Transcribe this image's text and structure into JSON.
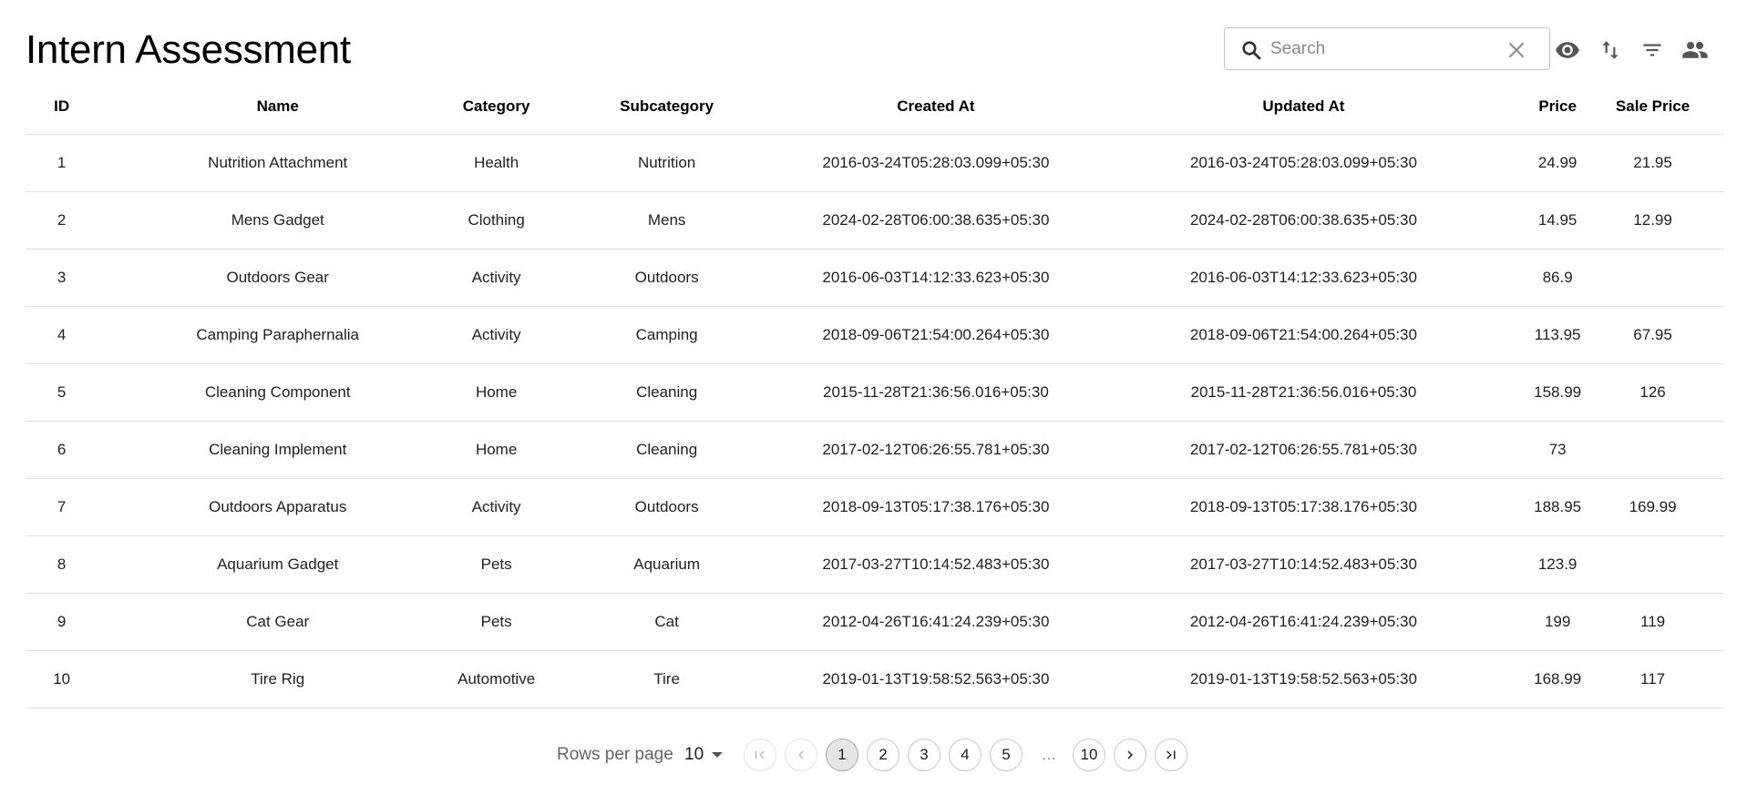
{
  "header": {
    "title": "Intern Assessment"
  },
  "search": {
    "placeholder": "Search",
    "value": ""
  },
  "toolbar_icons": [
    "eye-icon",
    "sort-arrows-icon",
    "filter-icon",
    "people-icon"
  ],
  "table": {
    "columns": [
      "ID",
      "Name",
      "Category",
      "Subcategory",
      "Created At",
      "Updated At",
      "Price",
      "Sale Price"
    ],
    "rows": [
      [
        "1",
        "Nutrition Attachment",
        "Health",
        "Nutrition",
        "2016-03-24T05:28:03.099+05:30",
        "2016-03-24T05:28:03.099+05:30",
        "24.99",
        "21.95"
      ],
      [
        "2",
        "Mens Gadget",
        "Clothing",
        "Mens",
        "2024-02-28T06:00:38.635+05:30",
        "2024-02-28T06:00:38.635+05:30",
        "14.95",
        "12.99"
      ],
      [
        "3",
        "Outdoors Gear",
        "Activity",
        "Outdoors",
        "2016-06-03T14:12:33.623+05:30",
        "2016-06-03T14:12:33.623+05:30",
        "86.9",
        ""
      ],
      [
        "4",
        "Camping Paraphernalia",
        "Activity",
        "Camping",
        "2018-09-06T21:54:00.264+05:30",
        "2018-09-06T21:54:00.264+05:30",
        "113.95",
        "67.95"
      ],
      [
        "5",
        "Cleaning Component",
        "Home",
        "Cleaning",
        "2015-11-28T21:36:56.016+05:30",
        "2015-11-28T21:36:56.016+05:30",
        "158.99",
        "126"
      ],
      [
        "6",
        "Cleaning Implement",
        "Home",
        "Cleaning",
        "2017-02-12T06:26:55.781+05:30",
        "2017-02-12T06:26:55.781+05:30",
        "73",
        ""
      ],
      [
        "7",
        "Outdoors Apparatus",
        "Activity",
        "Outdoors",
        "2018-09-13T05:17:38.176+05:30",
        "2018-09-13T05:17:38.176+05:30",
        "188.95",
        "169.99"
      ],
      [
        "8",
        "Aquarium Gadget",
        "Pets",
        "Aquarium",
        "2017-03-27T10:14:52.483+05:30",
        "2017-03-27T10:14:52.483+05:30",
        "123.9",
        ""
      ],
      [
        "9",
        "Cat Gear",
        "Pets",
        "Cat",
        "2012-04-26T16:41:24.239+05:30",
        "2012-04-26T16:41:24.239+05:30",
        "199",
        "119"
      ],
      [
        "10",
        "Tire Rig",
        "Automotive",
        "Tire",
        "2019-01-13T19:58:52.563+05:30",
        "2019-01-13T19:58:52.563+05:30",
        "168.99",
        "117"
      ]
    ]
  },
  "pagination": {
    "rows_per_page_label": "Rows per page",
    "rows_per_page_value": "10",
    "pages": [
      "1",
      "2",
      "3",
      "4",
      "5",
      "10"
    ],
    "current_page": "1",
    "ellipsis": "…"
  }
}
